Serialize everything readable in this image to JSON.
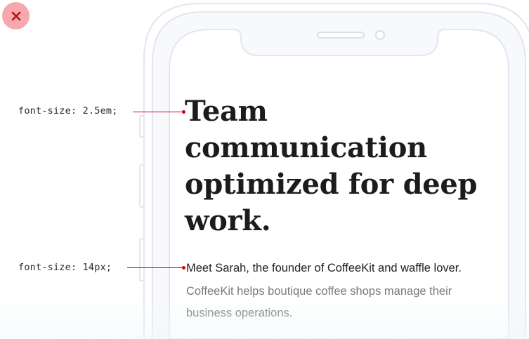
{
  "close_button": {
    "icon": "close-icon",
    "color": "#f6a8ad",
    "icon_color": "#b0101e"
  },
  "annotations": {
    "headline_label": "font-size: 2.5em;",
    "body_label": "font-size: 14px;",
    "leader_color": "#d0021b"
  },
  "screen": {
    "headline_lines": [
      "Team",
      "communication",
      "optimized for deep",
      "work."
    ],
    "lead": "Meet Sarah, the founder of CoffeeKit and waffle lover.",
    "body_lines": [
      "CoffeeKit helps boutique coffee shops manage their",
      "business operations."
    ]
  },
  "phone": {
    "outline_color": "#e4e6ee",
    "speaker_icon": "speaker-grille-icon",
    "camera_icon": "camera-icon"
  }
}
